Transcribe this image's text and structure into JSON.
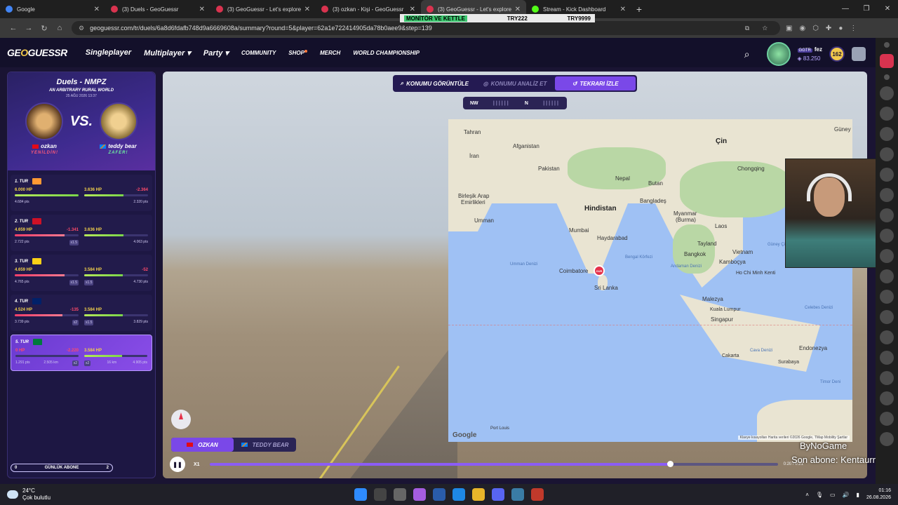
{
  "browser": {
    "tabs": [
      {
        "title": "Google",
        "color": "#4285f4"
      },
      {
        "title": "(3) Duels - GeoGuessr",
        "color": "#d9334f"
      },
      {
        "title": "(3) GeoGuessr - Let's explore th",
        "color": "#d9334f"
      },
      {
        "title": "(3) ozkan - Kişi - GeoGuessr",
        "color": "#d9334f"
      },
      {
        "title": "(3) GeoGuessr - Let's explore th",
        "color": "#d9334f"
      },
      {
        "title": "Stream - Kick Dashboard",
        "color": "#53fc18"
      }
    ],
    "active_tab_index": 4,
    "url": "geoguessr.com/tr/duels/6a8d6fdafb748d9a6669608a/summary?round=5&player=62a1e722414905da78b0aee9&step=139",
    "overlay_banner": {
      "left": "MONİTÖR VE KETTLE",
      "mid": "TRY222",
      "right": "TRY9999"
    }
  },
  "header": {
    "logo_pre": "GE",
    "logo_o": "O",
    "logo_post": "GUESSR",
    "nav": {
      "singleplayer": "Singleplayer",
      "multiplayer": "Multiplayer",
      "party": "Party",
      "community": "COMMUNITY",
      "shop": "SHOP",
      "merch": "MERCH",
      "world_championship": "WORLD CHAMPIONSHIP"
    },
    "user": {
      "tag": "GGTR",
      "name": "fez",
      "points": "83.250",
      "level": "162"
    }
  },
  "duel": {
    "title": "Duels - NMPZ",
    "map": "AN ARBITRARY RURAL WORLD",
    "date": "25 AĞU 2026 13:37",
    "vs": "VS.",
    "player1": {
      "name": "ozkan",
      "result": "YENİLDİN!"
    },
    "player2": {
      "name": "teddy bear",
      "result": "ZAFER!"
    }
  },
  "rounds": [
    {
      "label": "1. TUR",
      "p1_hp": "6.000 HP",
      "p1_dmg": "",
      "p1_pts": "4.684 pts",
      "p1_mult": "",
      "p1_fill": 1.0,
      "p2_hp": "3.636 HP",
      "p2_dmg": "-2.364",
      "p2_pts": "2.320 pts",
      "p2_mult": "",
      "p2_fill": 0.61,
      "flag": "#ff9933"
    },
    {
      "label": "2. TUR",
      "p1_hp": "4.659 HP",
      "p1_dmg": "-1.341",
      "p1_pts": "2.722 pts",
      "p1_mult": "x1.5",
      "p1_fill": 0.78,
      "p2_hp": "3.636 HP",
      "p2_dmg": "",
      "p2_pts": "4.063 pts",
      "p2_mult": "",
      "p2_fill": 0.61,
      "flag": "#ce1126"
    },
    {
      "label": "3. TUR",
      "p1_hp": "4.659 HP",
      "p1_dmg": "",
      "p1_pts": "4.765 pts",
      "p1_mult": "x1.5",
      "p1_fill": 0.78,
      "p2_hp": "3.584 HP",
      "p2_dmg": "-52",
      "p2_pts": "4.730 pts",
      "p2_mult": "x1.5",
      "p2_fill": 0.6,
      "flag": "#fcd116"
    },
    {
      "label": "4. TUR",
      "p1_hp": "4.524 HP",
      "p1_dmg": "-135",
      "p1_pts": "3.739 pts",
      "p1_mult": "x2",
      "p1_fill": 0.75,
      "p2_hp": "3.584 HP",
      "p2_dmg": "",
      "p2_pts": "3.829 pts",
      "p2_mult": "x1.5",
      "p2_fill": 0.6,
      "flag": "#012169"
    },
    {
      "label": "5. TUR",
      "p1_hp": "0 HP",
      "p1_dmg": "-2.220",
      "p1_pts": "1.291 pts",
      "p1_extra": "2.505 km",
      "p1_mult": "x2",
      "p1_fill": 0.0,
      "p2_hp": "3.584 HP",
      "p2_dmg": "",
      "p2_pts": "4.905 pts",
      "p2_extra": "16 km",
      "p2_mult": "x2",
      "p2_fill": 0.6,
      "flag": "#007a3d"
    }
  ],
  "subscribe": {
    "label": "GÜNLÜK ABONE",
    "left": "0",
    "right": "2"
  },
  "replay": {
    "modes": {
      "view_location": "KONUMU GÖRÜNTÜLE",
      "analyze": "KONUMU ANALİZ ET",
      "watch": "TEKRARI İZLE"
    },
    "compass": {
      "left": "NW",
      "mid": "N"
    },
    "player_tabs": {
      "p1": "OZKAN",
      "p2": "TEDDY BEAR"
    },
    "speed": "X1",
    "timecode": "0:20 / 0:21",
    "progress": 0.81
  },
  "map": {
    "labels": {
      "tahran": "Tahran",
      "iran": "İran",
      "afganistan": "Afganistan",
      "pakistan": "Pakistan",
      "nepal": "Nepal",
      "butan": "Butan",
      "cin": "Çin",
      "guney_kore": "Güney Ko",
      "hindistan": "Hindistan",
      "bangladesh": "Bangladeş",
      "chongqing": "Chongqing",
      "birlesik_arap": "Birleşik Arap",
      "emirlikleri": "Emirlikleri",
      "umman": "Umman",
      "myanmar": "Myanmar",
      "burma": "(Burma)",
      "mumbai": "Mumbai",
      "haydarabad": "Haydarabad",
      "laos": "Laos",
      "tayland": "Tayland",
      "vietnam": "Vietnam",
      "bangkok": "Bangkok",
      "kambocya": "Kamboçya",
      "coimbatore": "Coimbatore",
      "sri_lanka": "Sri Lanka",
      "ho_chi_minh": "Ho Chi Minh Kenti",
      "malezya": "Malezya",
      "kuala_lumpur": "Kuala Lumpur",
      "singapur": "Singapur",
      "endonezya": "Endonezya",
      "cakarta": "Cakarta",
      "surabaya": "Surabaya",
      "port_louis": "Port Louis",
      "umman_denizi": "Umman Denizi",
      "bengal_korfezi": "Bengal Körfezi",
      "andaman_denizi": "Andaman Denizi",
      "gney_cin": "Güney Çin",
      "cava_denizi": "Cava Denizi",
      "timor_denizi": "Timor Deni",
      "celebes": "Celebes Denizi"
    },
    "marker": "OUR",
    "attribution": "Klavye kısayolları   Harita verileri ©2026 Google, TMap Mobility   Şartlar",
    "logo": "Google"
  },
  "overlays": {
    "line1": "ByNoGame",
    "line2": "Son abone: Kentaurrr"
  },
  "taskbar": {
    "temp": "24°C",
    "weather": "Çok bulutlu",
    "time": "01:16",
    "date": "26.08.2026"
  }
}
